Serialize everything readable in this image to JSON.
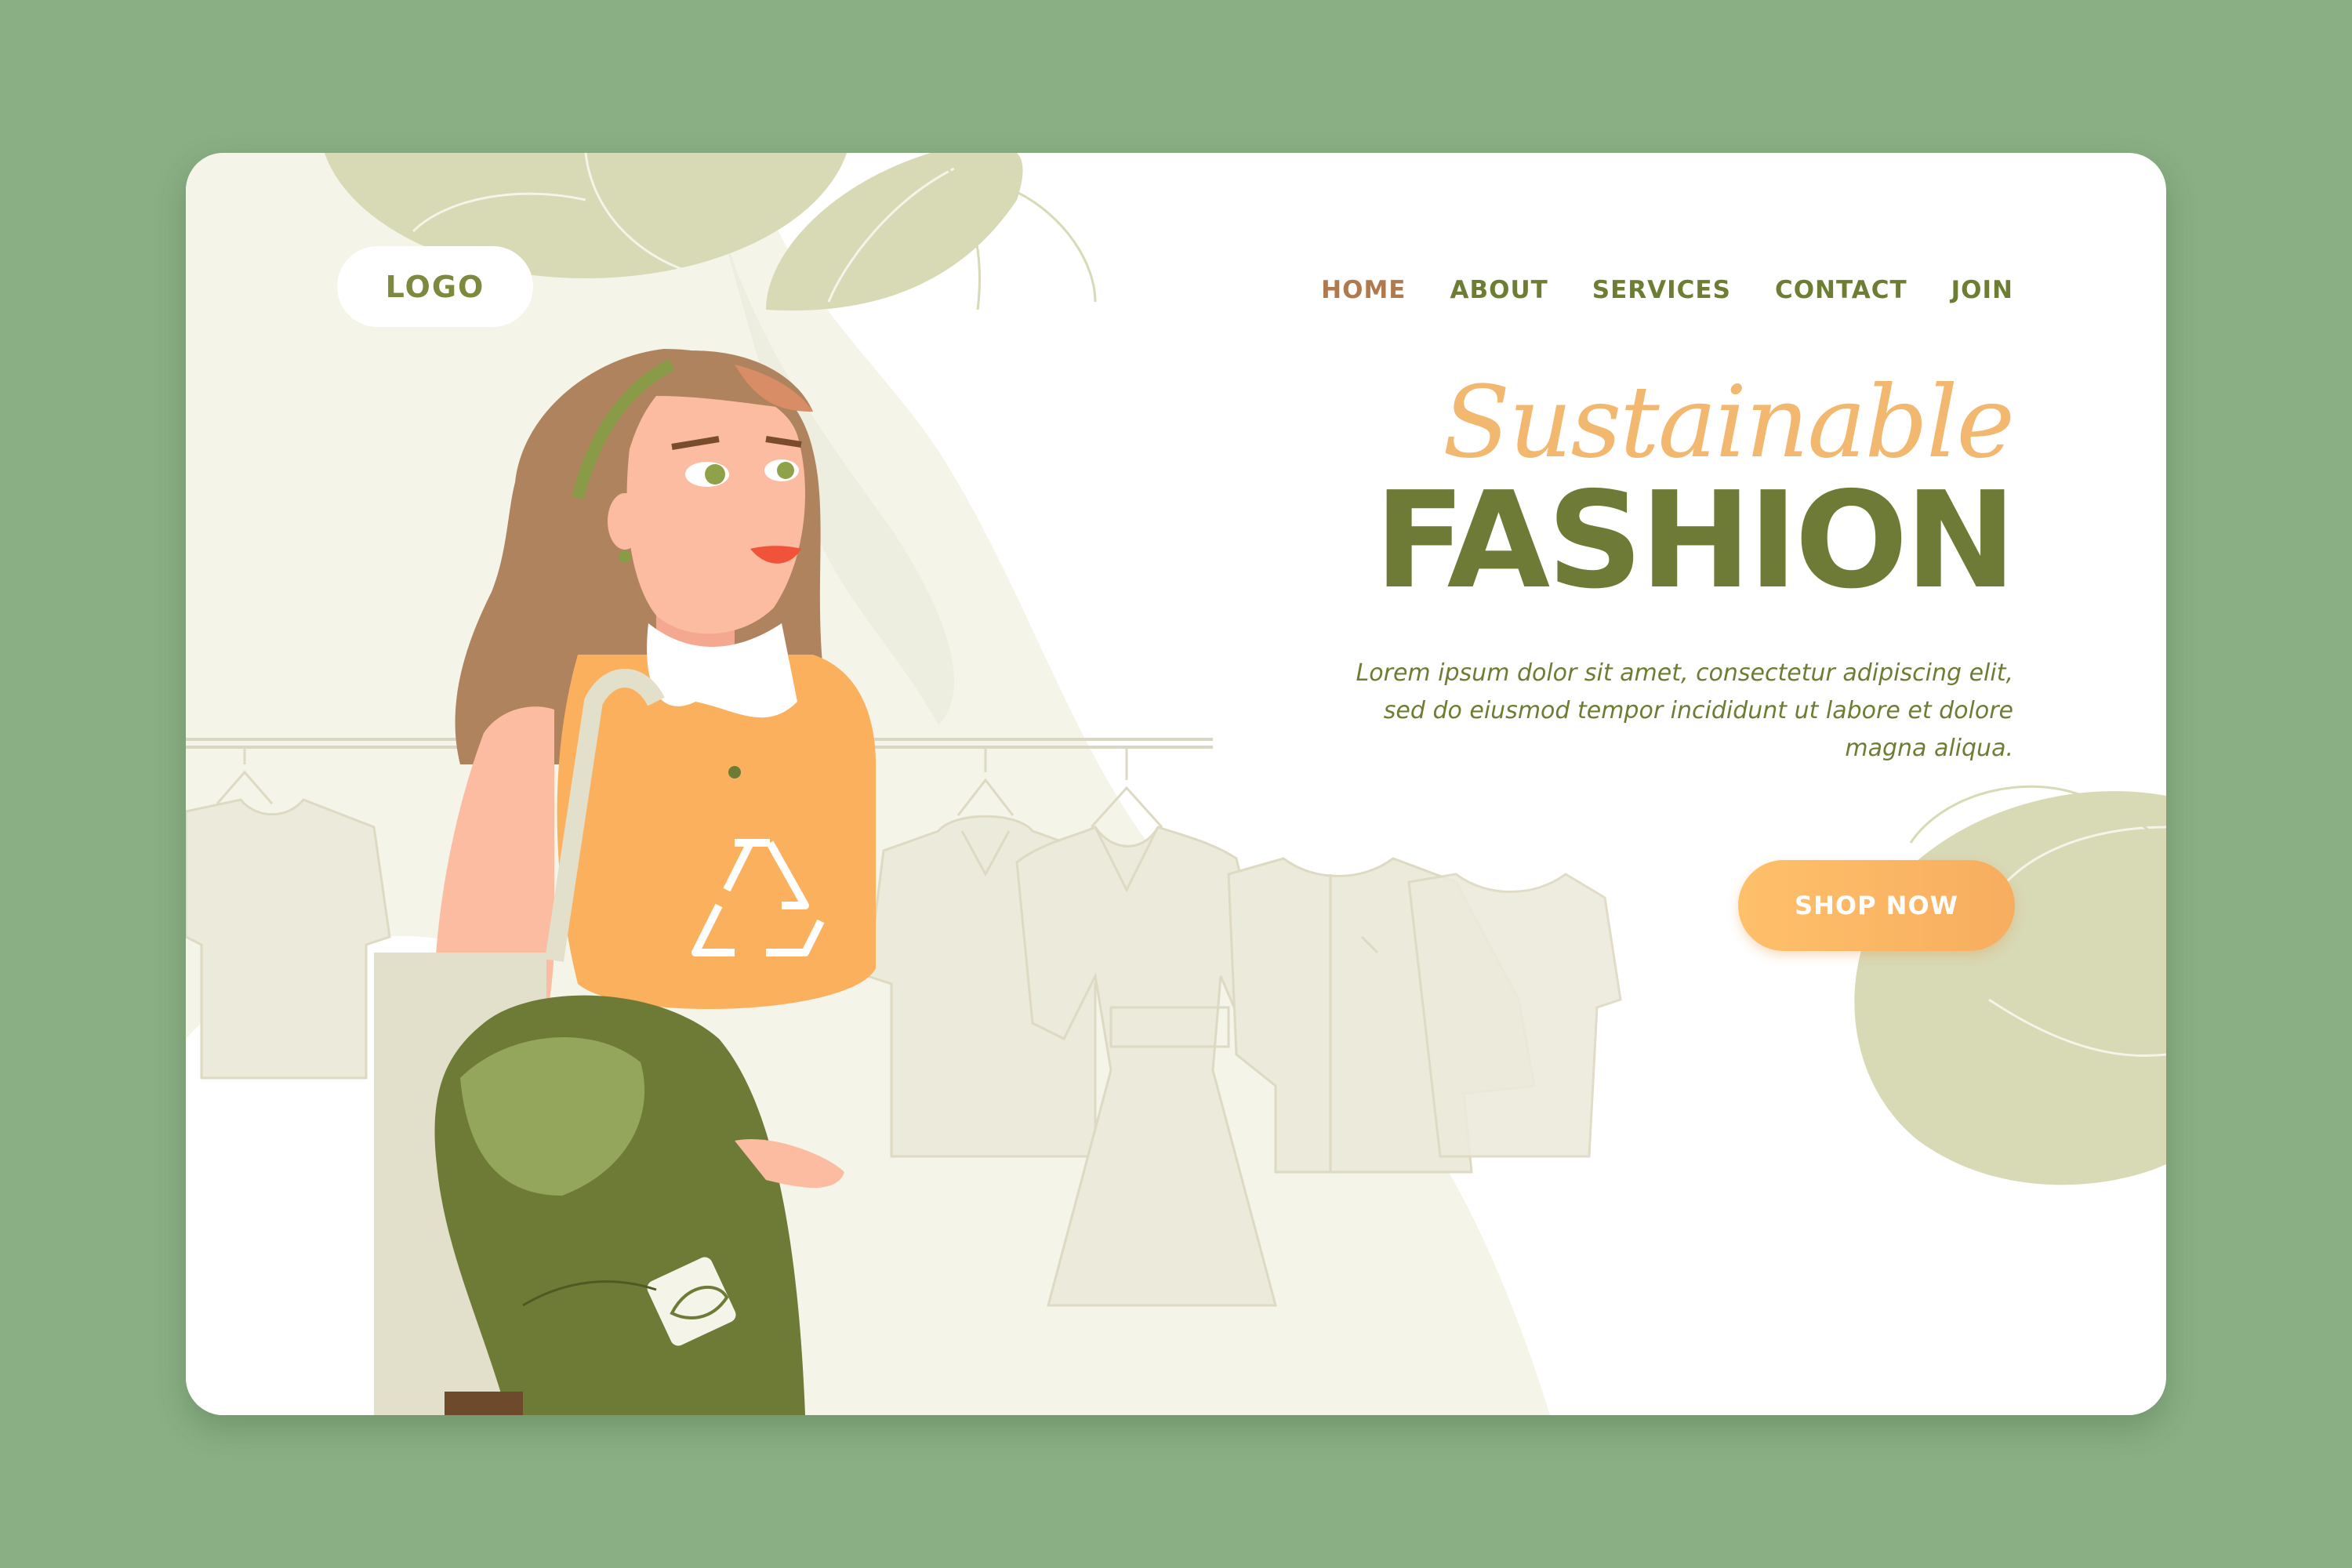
{
  "header": {
    "logo": "LOGO",
    "nav": [
      {
        "label": "HOME",
        "active": true
      },
      {
        "label": "ABOUT"
      },
      {
        "label": "SERVICES"
      },
      {
        "label": "CONTACT"
      },
      {
        "label": "JOIN"
      }
    ]
  },
  "hero": {
    "subtitle": "Sustainable",
    "title": "FASHION",
    "description": "Lorem ipsum dolor sit amet, consectetur adipiscing elit, sed do eiusmod tempor incididunt ut labore et dolore magna aliqua.",
    "cta_label": "SHOP NOW"
  },
  "colors": {
    "page_background": "#8aaf84",
    "card_background": "#ffffff",
    "cream_shape": "#f4f4e8",
    "leaf_shape": "#d8d9b5",
    "olive_text": "#6e7b36",
    "nav_active": "#b07a4e",
    "accent_orange": "#f7b264"
  },
  "icons": {
    "shirt_emblem": "recycle-icon",
    "clothing_tag": "leaf-icon"
  }
}
